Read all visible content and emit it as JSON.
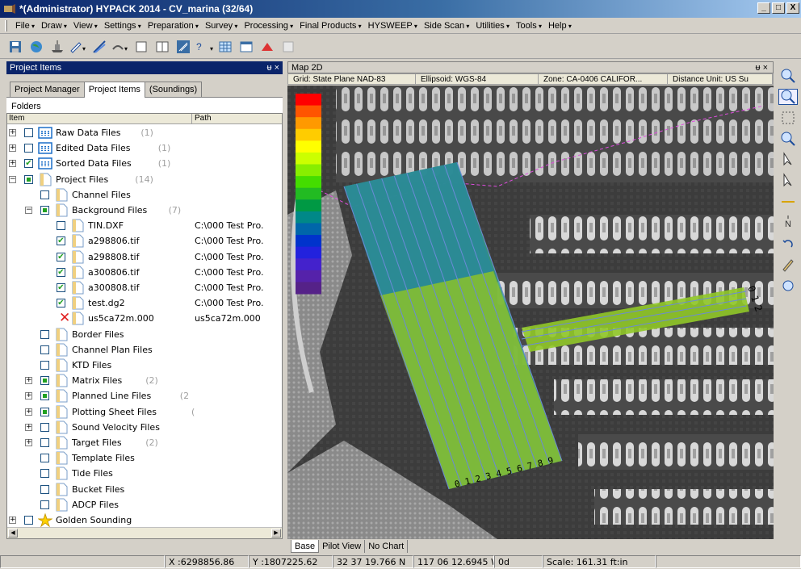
{
  "window": {
    "title": "*(Administrator) HYPACK 2014 - CV_marina (32/64)",
    "btn_min": "_",
    "btn_max": "□",
    "btn_close": "X"
  },
  "menu": [
    "File",
    "Draw",
    "View",
    "Settings",
    "Preparation",
    "Survey",
    "Processing",
    "Final Products",
    "HYSWEEP",
    "Side Scan",
    "Utilities",
    "Tools",
    "Help"
  ],
  "panel": {
    "title": "Project Items",
    "controls": "ᵾ ×",
    "tabs": [
      "Project Manager",
      "Project Items",
      "(Soundings)"
    ],
    "folders_label": "Folders",
    "col_item": "Item",
    "col_path": "Path"
  },
  "tree": [
    {
      "label": "Raw Data Files",
      "count": "(1)"
    },
    {
      "label": "Edited Data Files",
      "count": "(1)"
    },
    {
      "label": "Sorted Data Files",
      "count": "(1)"
    },
    {
      "label": "Project Files",
      "count": "(14)"
    },
    {
      "label": "Channel Files",
      "count": ""
    },
    {
      "label": "Background Files",
      "count": "(7)"
    },
    {
      "label": "TIN.DXF",
      "path": "C:\\000 Test Pro."
    },
    {
      "label": "a298806.tif",
      "path": "C:\\000 Test Pro."
    },
    {
      "label": "a298808.tif",
      "path": "C:\\000 Test Pro."
    },
    {
      "label": "a300806.tif",
      "path": "C:\\000 Test Pro."
    },
    {
      "label": "a300808.tif",
      "path": "C:\\000 Test Pro."
    },
    {
      "label": "test.dg2",
      "path": "C:\\000 Test Pro."
    },
    {
      "label": "us5ca72m.000",
      "path": "us5ca72m.000"
    },
    {
      "label": "Border Files",
      "count": ""
    },
    {
      "label": "Channel Plan Files",
      "count": ""
    },
    {
      "label": "KTD Files",
      "count": ""
    },
    {
      "label": "Matrix Files",
      "count": "(2)"
    },
    {
      "label": "Planned Line Files",
      "count": "(2"
    },
    {
      "label": "Plotting Sheet Files",
      "count": "("
    },
    {
      "label": "Sound Velocity Files",
      "count": ""
    },
    {
      "label": "Target Files",
      "count": "(2)"
    },
    {
      "label": "Template Files",
      "count": ""
    },
    {
      "label": "Tide Files",
      "count": ""
    },
    {
      "label": "Bucket Files",
      "count": ""
    },
    {
      "label": "ADCP Files",
      "count": ""
    },
    {
      "label": "Golden Sounding",
      "count": ""
    },
    {
      "label": "Archive",
      "count": ""
    }
  ],
  "map": {
    "title": "Map 2D",
    "controls": "ᵾ ×",
    "grid": "Grid: State Plane NAD-83",
    "ellipsoid": "Ellipsoid: WGS-84",
    "zone": "Zone: CA-0406 CALIFOR...",
    "units": "Distance Unit: US Su",
    "tabs": [
      "Base",
      "Pilot View",
      "No Chart"
    ],
    "line_labels_right": [
      "0",
      "1",
      "2"
    ],
    "line_labels_bottom": "0 1 2 3 4 5 6 7 8 9"
  },
  "status": {
    "x": "X :6298856.86",
    "y": "Y :1807225.62",
    "lat": "32 37 19.766 N",
    "lon": "117 06 12.6945 W",
    "heading": "0d",
    "scale": "Scale: 161.31 ft:in"
  },
  "colors": {
    "titlebar": "#0a246a",
    "legend": [
      "#ff0000",
      "#ff5500",
      "#ff9900",
      "#ffcc00",
      "#ffff00",
      "#ccff00",
      "#88ee00",
      "#44dd00",
      "#22bb22",
      "#009944",
      "#008888",
      "#0066aa",
      "#0033cc",
      "#2222dd",
      "#4422cc",
      "#5522aa",
      "#552288"
    ]
  }
}
